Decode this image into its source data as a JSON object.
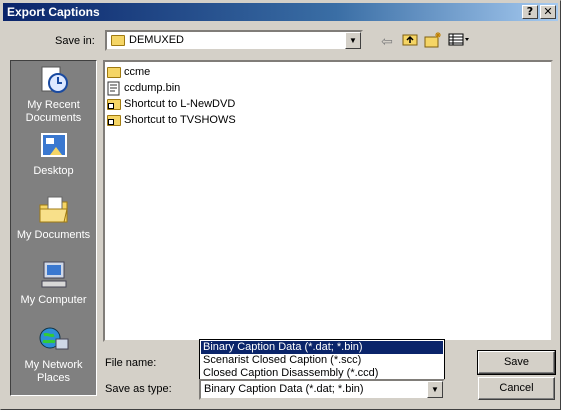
{
  "window": {
    "title": "Export Captions",
    "help_glyph": "?",
    "close_glyph": "✕"
  },
  "toolbar": {
    "save_in_label": "Save in:",
    "save_in_value": "DEMUXED",
    "icons": [
      "back-icon",
      "up-folder-icon",
      "new-folder-icon",
      "view-menu-icon"
    ]
  },
  "places": [
    {
      "label": "My Recent Documents",
      "icon": "recent-documents-icon"
    },
    {
      "label": "Desktop",
      "icon": "desktop-icon"
    },
    {
      "label": "My Documents",
      "icon": "my-documents-icon"
    },
    {
      "label": "My Computer",
      "icon": "my-computer-icon"
    },
    {
      "label": "My Network Places",
      "icon": "network-places-icon"
    }
  ],
  "files": [
    {
      "name": "ccme",
      "icon": "folder-icon"
    },
    {
      "name": "ccdump.bin",
      "icon": "file-icon"
    },
    {
      "name": "Shortcut to L-NewDVD",
      "icon": "folder-shortcut-icon"
    },
    {
      "name": "Shortcut to TVSHOWS",
      "icon": "folder-shortcut-icon"
    }
  ],
  "form": {
    "file_name_label": "File name:",
    "file_name_value": "",
    "save_as_type_label": "Save as type:",
    "save_as_type_value": "Binary Caption Data (*.dat; *.bin)",
    "type_options": [
      "Binary Caption Data (*.dat; *.bin)",
      "Scenarist Closed Caption (*.scc)",
      "Closed Caption Disassembly (*.ccd)"
    ],
    "selected_option_index": 0
  },
  "buttons": {
    "save": "Save",
    "cancel": "Cancel"
  },
  "colors": {
    "title_bar": "#0a246a",
    "selection": "#0a246a",
    "places_bg": "#808080",
    "dialog_bg": "#d4d0c8"
  }
}
